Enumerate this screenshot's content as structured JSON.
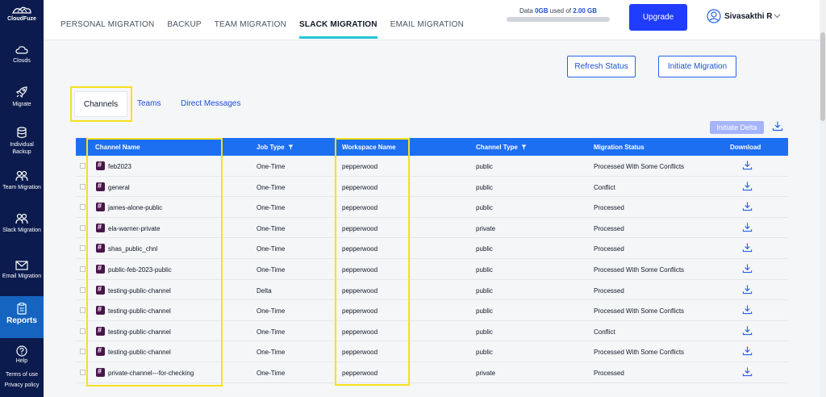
{
  "sidebar": {
    "logo_text": "CloudFuze",
    "items": [
      {
        "label": "Clouds",
        "icon": "cloud-icon"
      },
      {
        "label": "Migrate",
        "icon": "rocket-icon"
      },
      {
        "label": "Individual Backup",
        "icon": "database-icon"
      },
      {
        "label": "Team Migration",
        "icon": "team-icon"
      },
      {
        "label": "Slack Migration",
        "icon": "slack-team-icon"
      },
      {
        "label": "Email Migration",
        "icon": "email-icon"
      },
      {
        "label": "Reports",
        "icon": "report-icon"
      }
    ],
    "help": "Help",
    "terms": "Terms of use",
    "privacy": "Privacy policy"
  },
  "header": {
    "tabs": [
      "PERSONAL MIGRATION",
      "BACKUP",
      "TEAM MIGRATION",
      "SLACK MIGRATION",
      "EMAIL MIGRATION"
    ],
    "active_tab": "SLACK MIGRATION",
    "storage_prefix": "Data",
    "storage_used": "0GB",
    "storage_mid": "used of",
    "storage_total": "2.00 GB",
    "storage_fraction": 0,
    "upgrade_label": "Upgrade",
    "user_name": "Sivasakthi R"
  },
  "actions": {
    "refresh_label": "Refresh Status",
    "initiate_label": "Initiate Migration",
    "delta_label": "Initiate Delta"
  },
  "subtabs": {
    "channels": "Channels",
    "teams": "Teams",
    "direct": "Direct Messages"
  },
  "table": {
    "headers": {
      "channel": "Channel Name",
      "job": "Job Type",
      "workspace": "Workspace Name",
      "type": "Channel Type",
      "status": "Migration Status",
      "download": "Download"
    },
    "rows": [
      {
        "channel": "feb2023",
        "job": "One-Time",
        "workspace": "pepperwood",
        "type": "public",
        "status": "Processed With Some Conflicts"
      },
      {
        "channel": "general",
        "job": "One-Time",
        "workspace": "pepperwood",
        "type": "public",
        "status": "Conflict"
      },
      {
        "channel": "james-alone-public",
        "job": "One-Time",
        "workspace": "pepperwood",
        "type": "public",
        "status": "Processed"
      },
      {
        "channel": "ela-warner-private",
        "job": "One-Time",
        "workspace": "pepperwood",
        "type": "private",
        "status": "Processed"
      },
      {
        "channel": "shas_public_chnl",
        "job": "One-Time",
        "workspace": "pepperwood",
        "type": "public",
        "status": "Processed"
      },
      {
        "channel": "public-feb-2023-public",
        "job": "One-Time",
        "workspace": "pepperwood",
        "type": "public",
        "status": "Processed With Some Conflicts"
      },
      {
        "channel": "testing-public-channel",
        "job": "Delta",
        "workspace": "pepperwood",
        "type": "public",
        "status": "Processed"
      },
      {
        "channel": "testing-public-channel",
        "job": "One-Time",
        "workspace": "pepperwood",
        "type": "public",
        "status": "Processed With Some Conflicts"
      },
      {
        "channel": "testing-public-channel",
        "job": "One-Time",
        "workspace": "pepperwood",
        "type": "public",
        "status": "Conflict"
      },
      {
        "channel": "testing-public-channel",
        "job": "One-Time",
        "workspace": "pepperwood",
        "type": "public",
        "status": "Processed With Some Conflicts"
      },
      {
        "channel": "private-channel---for-checking",
        "job": "One-Time",
        "workspace": "pepperwood",
        "type": "private",
        "status": "Processed"
      }
    ]
  },
  "colors": {
    "sidebar": "#0b1b4d",
    "accent": "#1d6ff2",
    "highlight": "#f5e11c",
    "tab_underline": "#22c5d8"
  }
}
